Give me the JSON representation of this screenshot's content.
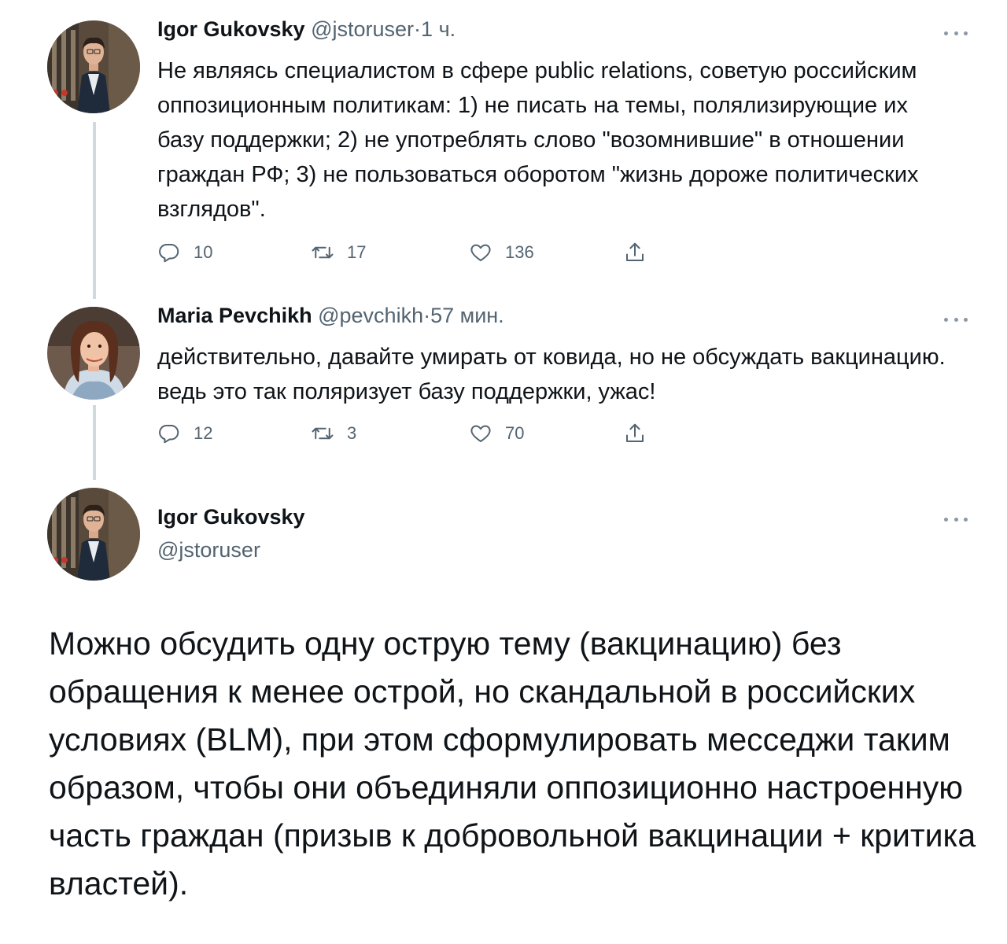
{
  "tweets": [
    {
      "name": "Igor Gukovsky",
      "handle": "@jstoruser",
      "separator": "·",
      "time": "1 ч.",
      "text": "Не являясь специалистом в сфере public relations, советую российским оппозиционным политикам: 1) не писать на темы, полялизирующие их базу поддержки; 2) не употреблять слово \"возомнившие\" в отношении граждан РФ; 3) не пользоваться оборотом \"жизнь дороже политических взглядов\".",
      "replies": "10",
      "retweets": "17",
      "likes": "136"
    },
    {
      "name": "Maria Pevchikh",
      "handle": "@pevchikh",
      "separator": "·",
      "time": "57 мин.",
      "text": "действительно, давайте умирать от ковида, но не обсуждать вакцинацию. ведь это так поляризует базу поддержки, ужас!",
      "replies": "12",
      "retweets": "3",
      "likes": "70"
    }
  ],
  "focused_tweet": {
    "name": "Igor Gukovsky",
    "handle": "@jstoruser",
    "text": "Можно обсудить одну острую тему (вакцинацию) без обращения к менее острой, но скандальной в российских условиях (BLM), при этом сформулировать месседжи таким образом, чтобы они объединяли оппозиционно настроенную часть граждан (призыв к добровольной вакцинации + критика властей)."
  },
  "icons": {
    "more": "more-horizontal-icon",
    "reply": "reply-icon",
    "retweet": "retweet-icon",
    "like": "heart-icon",
    "share": "share-icon"
  },
  "colors": {
    "text_primary": "#0f1419",
    "text_secondary": "#536471",
    "thread_line": "#cfd9de"
  }
}
